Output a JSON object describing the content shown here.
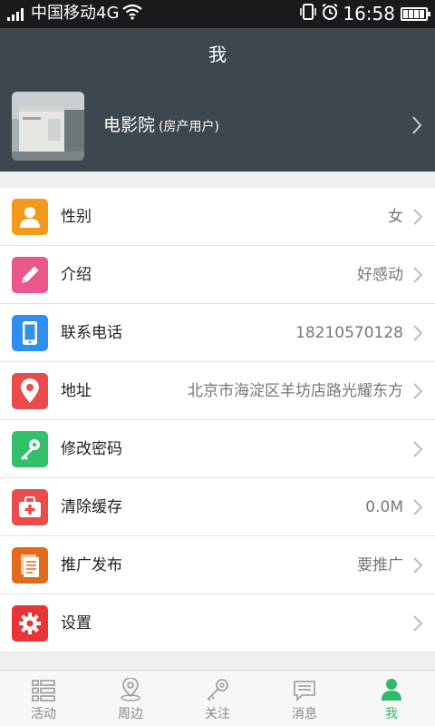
{
  "status_bar": {
    "carrier": "中国移动4G",
    "time": "16:58"
  },
  "header": {
    "title": "我"
  },
  "profile": {
    "name": "电影院",
    "role": "(房产用户)"
  },
  "settings": {
    "gender": {
      "label": "性别",
      "value": "女"
    },
    "intro": {
      "label": "介绍",
      "value": "好感动"
    },
    "phone": {
      "label": "联系电话",
      "value": "18210570128"
    },
    "address": {
      "label": "地址",
      "value": "北京市海淀区羊坊店路光耀东方"
    },
    "password": {
      "label": "修改密码",
      "value": ""
    },
    "cache": {
      "label": "清除缓存",
      "value": "0.0M"
    },
    "promote": {
      "label": "推广发布",
      "value": "要推广"
    },
    "settings": {
      "label": "设置",
      "value": ""
    }
  },
  "tabs": {
    "activity": "活动",
    "nearby": "周边",
    "follow": "关注",
    "messages": "消息",
    "me": "我"
  },
  "colors": {
    "header_bg": "#3e4650",
    "active_tab": "#2fb96a",
    "gender_icon": "#f39a1a",
    "intro_icon": "#e9588c",
    "phone_icon": "#2f8ff0",
    "address_icon": "#ea4c4c",
    "password_icon": "#33c06a",
    "cache_icon": "#ea4c4c",
    "promote_icon": "#e26a1c",
    "settings_icon": "#e83434"
  }
}
